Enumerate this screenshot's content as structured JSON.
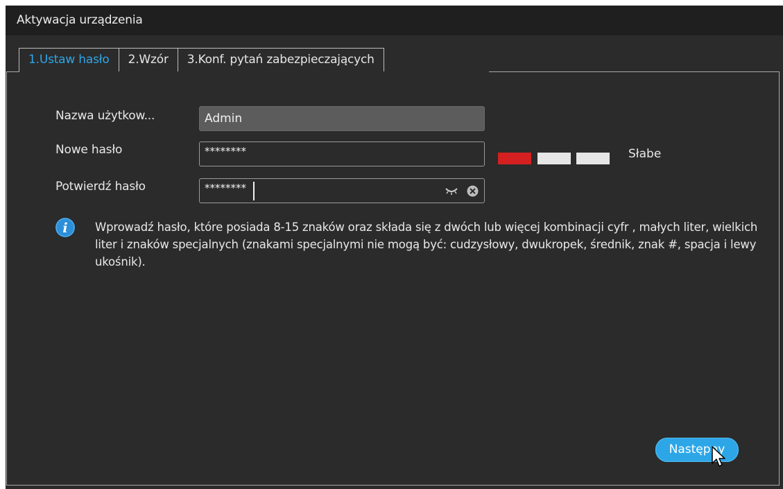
{
  "window": {
    "title": "Aktywacja urządzenia"
  },
  "tabs": [
    {
      "label": "1.Ustaw hasło",
      "active": true
    },
    {
      "label": "2.Wzór",
      "active": false
    },
    {
      "label": "3.Konf. pytań zabezpieczających",
      "active": false
    }
  ],
  "form": {
    "username_label": "Nazwa użytkow...",
    "username_value": "Admin",
    "new_password_label": "Nowe hasło",
    "new_password_value": "********",
    "confirm_password_label": "Potwierdź hasło",
    "confirm_password_value": "********"
  },
  "strength": {
    "label": "Słabe",
    "level": 1,
    "max": 3,
    "colors": {
      "active": "#d42020",
      "inactive": "#e6e6e6"
    }
  },
  "info": {
    "text": "Wprowadź hasło, które posiada 8-15 znaków oraz składa się z dwóch lub więcej kombinacji cyfr , małych liter, wielkich liter i znaków specjalnych (znakami specjalnymi nie mogą być: cudzysłowy, dwukropek, średnik, znak #, spacja i lewy ukośnik)."
  },
  "buttons": {
    "next_label": "Następny"
  },
  "colors": {
    "accent": "#2da6e8",
    "background": "#2b2b2b",
    "titlebar": "#1f1f1f"
  },
  "icons": [
    "info-icon",
    "eye-icon",
    "clear-icon",
    "mouse-cursor-icon"
  ]
}
